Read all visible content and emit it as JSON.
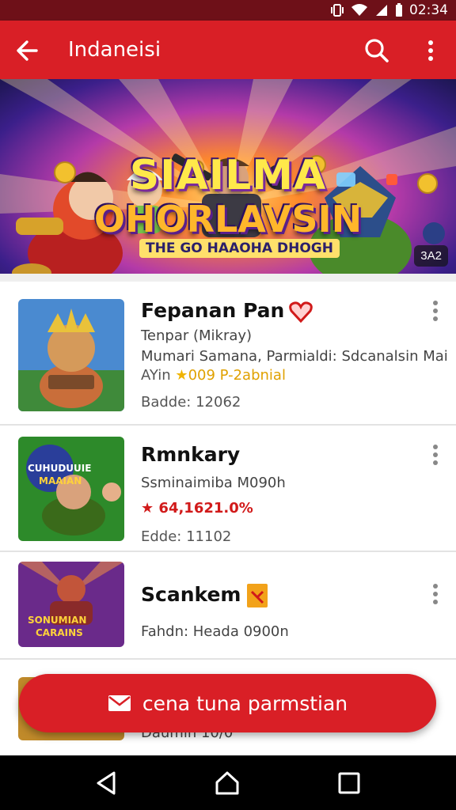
{
  "status_bar": {
    "time": "02:34",
    "icons": [
      "vibrate-icon",
      "wifi-icon",
      "signal-icon",
      "battery-icon"
    ]
  },
  "app_bar": {
    "title": "Indaneisi",
    "icons": [
      "back-arrow-icon",
      "search-icon",
      "more-vert-icon"
    ]
  },
  "banner": {
    "title_line1": "SIAILMA",
    "title_line2": "OHORLAVSIN",
    "tagline": "THE GO HAAOHA DHOGH",
    "badge": "3A2"
  },
  "items": [
    {
      "title": "Fepanan Pan",
      "tag_icon": "heart-badge-icon",
      "line1": "Tenpar (Mikray)",
      "line2": "Mumari Samana, Parmialdi: Sdcanalsin Mai",
      "rating_prefix": "AYin",
      "rating_value": "009 P-2abnial",
      "size": "Badde: 12062",
      "thumb_label": ""
    },
    {
      "title": "Rmnkary",
      "line1": "Ssminaimiba M090h",
      "price": "64,1621.0%",
      "size": "Edde: 11102",
      "thumb_label": "CUHUDUUIE MAAIAN"
    },
    {
      "title": "Scankem",
      "tag_icon": "gift-tag-icon",
      "line1": "Fahdn: Heada 0900n",
      "thumb_label": "SONUMIAN CARAINS"
    }
  ],
  "partial_item_text": "Daumin 10/0",
  "cta": {
    "label": "cena tuna parmstian",
    "icon": "mail-icon"
  },
  "colors": {
    "primary": "#d91f26",
    "status_bar": "#6e1018",
    "rating": "#e0a100",
    "price": "#d11a1a"
  }
}
